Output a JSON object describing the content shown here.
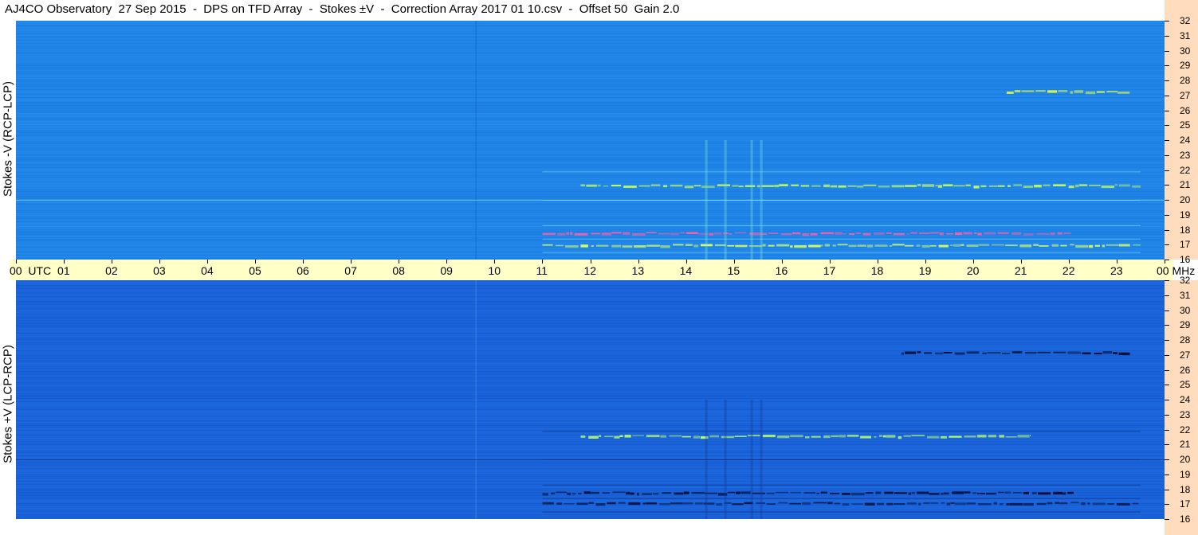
{
  "header": {
    "title": "AJ4CO Observatory  27 Sep 2015  -  DPS on TFD Array  -  Stokes ±V  -  Correction Array 2017 01 10.csv  -  Offset 50  Gain 2.0"
  },
  "chart_data": [
    {
      "type": "heatmap",
      "ylabel": "Stokes -V (RCP-LCP)",
      "x_unit": "UTC",
      "y_unit": "MHz",
      "xlim": [
        0,
        24
      ],
      "ylim": [
        16,
        32
      ],
      "base_color": "#1f84e6",
      "features": [
        {
          "freq_mhz": 17.8,
          "t_start": 11.0,
          "t_end": 22.1,
          "color": "#ff5fa8",
          "note_text": ""
        },
        {
          "freq_mhz": 17.0,
          "t_start": 11.0,
          "t_end": 23.5,
          "color": "#d6ff60"
        },
        {
          "freq_mhz": 21.0,
          "t_start": 11.8,
          "t_end": 23.5,
          "color": "#c8ff5a"
        },
        {
          "freq_mhz": 27.3,
          "t_start": 20.7,
          "t_end": 23.3,
          "color": "#e6ff3c"
        }
      ]
    },
    {
      "type": "heatmap",
      "ylabel": "Stokes +V (LCP-RCP)",
      "x_unit": "UTC",
      "y_unit": "MHz",
      "xlim": [
        0,
        24
      ],
      "ylim": [
        16,
        32
      ],
      "base_color": "#1a63d8",
      "features": [
        {
          "freq_mhz": 17.8,
          "t_start": 11.0,
          "t_end": 22.1,
          "color": "#050a30"
        },
        {
          "freq_mhz": 17.1,
          "t_start": 11.0,
          "t_end": 23.5,
          "color": "#0a1448"
        },
        {
          "freq_mhz": 21.6,
          "t_start": 11.8,
          "t_end": 21.2,
          "color": "#b8ff70"
        },
        {
          "freq_mhz": 27.2,
          "t_start": 18.5,
          "t_end": 23.3,
          "color": "#050a30"
        }
      ]
    }
  ],
  "time_axis": {
    "labels": [
      "00  UTC",
      "01",
      "02",
      "03",
      "04",
      "05",
      "06",
      "07",
      "08",
      "09",
      "10",
      "11",
      "12",
      "13",
      "14",
      "15",
      "16",
      "17",
      "18",
      "19",
      "20",
      "21",
      "22",
      "23",
      "00 MHz"
    ]
  },
  "freq_axis": {
    "labels": [
      "32",
      "31",
      "30",
      "29",
      "28",
      "27",
      "26",
      "25",
      "24",
      "23",
      "22",
      "21",
      "20",
      "19",
      "18",
      "17",
      "16"
    ]
  }
}
